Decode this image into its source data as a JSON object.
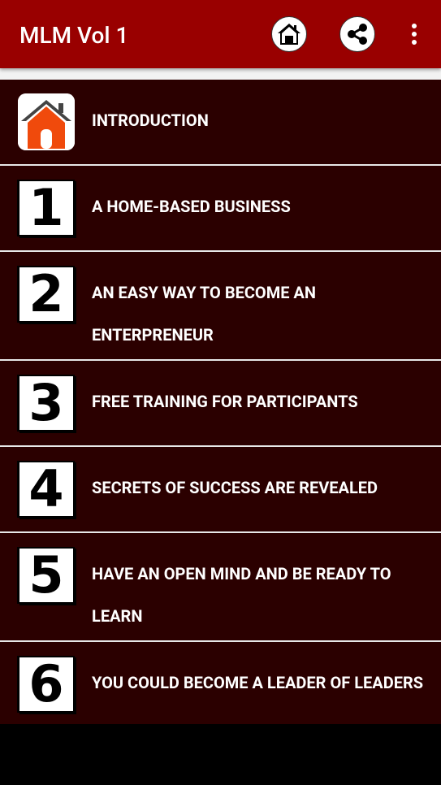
{
  "app_bar": {
    "title": "MLM Vol 1",
    "background_color": "#990000",
    "actions": [
      "home-icon",
      "share-icon",
      "overflow-menu-icon"
    ]
  },
  "list": {
    "row_background_color": "#2b0000",
    "items": [
      {
        "badge": "",
        "icon": "house-icon",
        "label": "INTRODUCTION"
      },
      {
        "badge": "1",
        "icon": "number-one-icon",
        "label": "A HOME-BASED BUSINESS"
      },
      {
        "badge": "2",
        "icon": "number-two-icon",
        "label": "AN EASY WAY TO BECOME AN ENTERPRENEUR"
      },
      {
        "badge": "3",
        "icon": "number-three-icon",
        "label": "FREE TRAINING FOR PARTICIPANTS"
      },
      {
        "badge": "4",
        "icon": "number-four-icon",
        "label": "SECRETS OF SUCCESS ARE REVEALED"
      },
      {
        "badge": "5",
        "icon": "number-five-icon",
        "label": "HAVE AN OPEN MIND AND BE READY TO LEARN"
      },
      {
        "badge": "6",
        "icon": "number-six-icon",
        "label": "YOU COULD BECOME A LEADER OF LEADERS"
      }
    ]
  }
}
